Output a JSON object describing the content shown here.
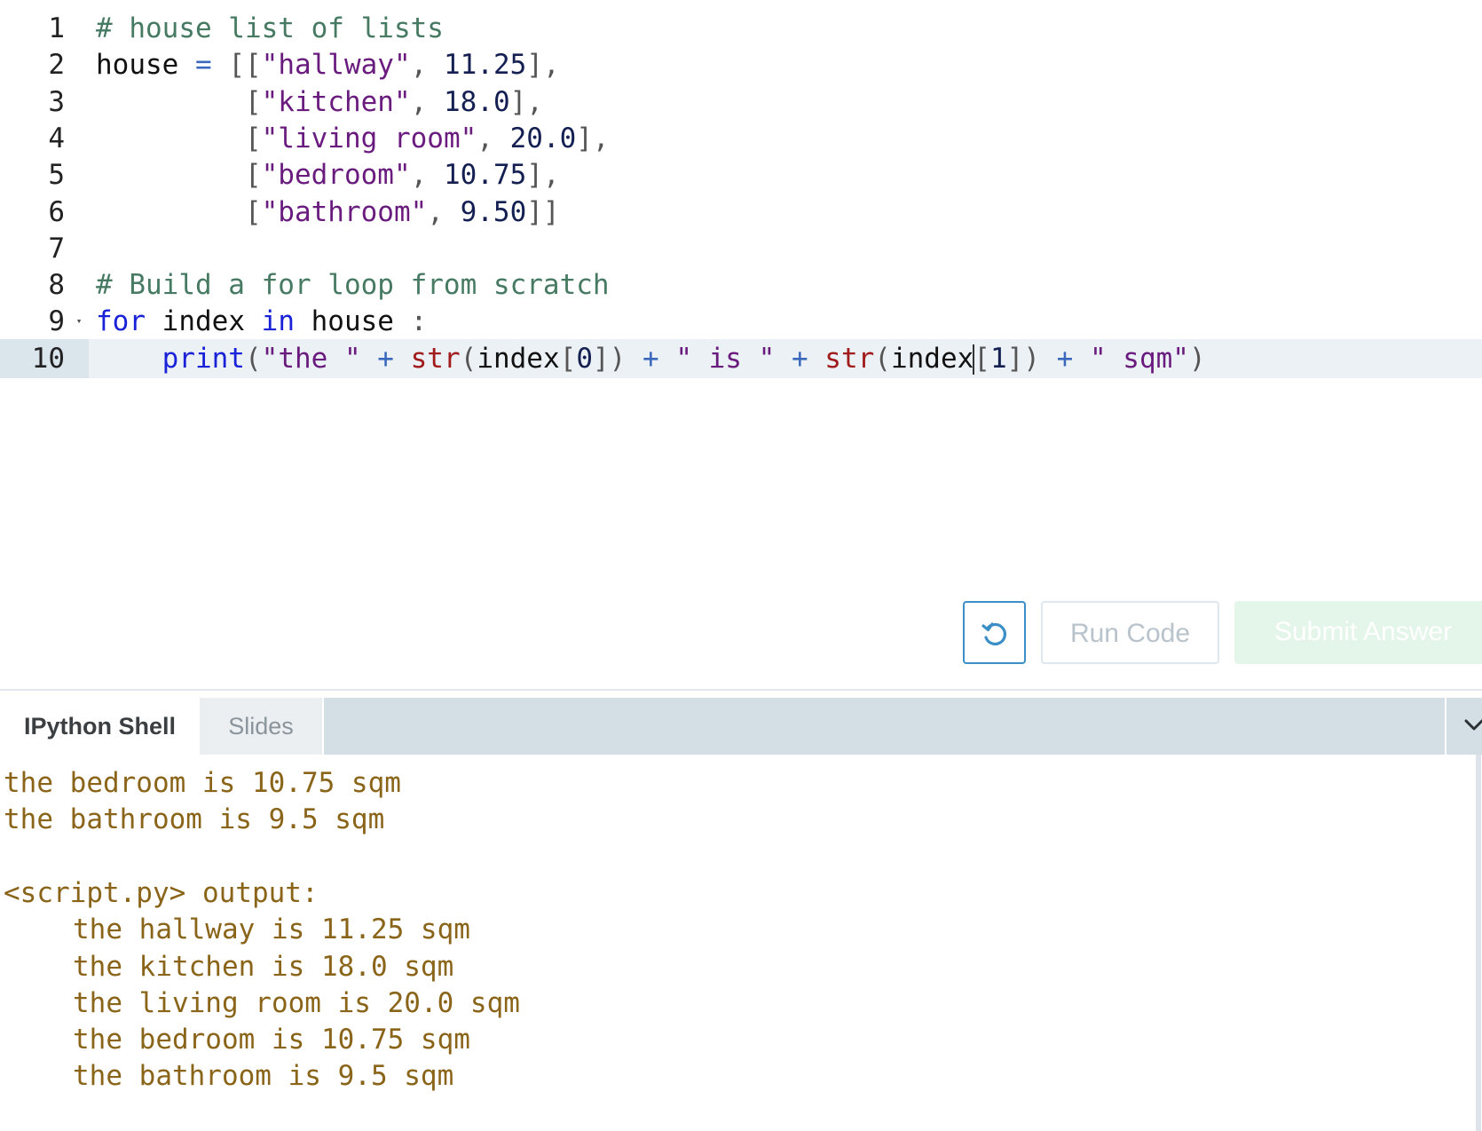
{
  "editor": {
    "active_line": 10,
    "lines": [
      {
        "num": "1",
        "tokens": [
          {
            "t": "# house list of lists",
            "c": "cm"
          }
        ]
      },
      {
        "num": "2",
        "tokens": [
          {
            "t": "house",
            "c": "id"
          },
          {
            "t": " = ",
            "c": "op"
          },
          {
            "t": "[[",
            "c": "pn"
          },
          {
            "t": "\"hallway\"",
            "c": "st"
          },
          {
            "t": ", ",
            "c": "pn"
          },
          {
            "t": "11.25",
            "c": "nm"
          },
          {
            "t": "],",
            "c": "pn"
          }
        ]
      },
      {
        "num": "3",
        "tokens": [
          {
            "t": "         [",
            "c": "pn"
          },
          {
            "t": "\"kitchen\"",
            "c": "st"
          },
          {
            "t": ", ",
            "c": "pn"
          },
          {
            "t": "18.0",
            "c": "nm"
          },
          {
            "t": "],",
            "c": "pn"
          }
        ]
      },
      {
        "num": "4",
        "tokens": [
          {
            "t": "         [",
            "c": "pn"
          },
          {
            "t": "\"living room\"",
            "c": "st"
          },
          {
            "t": ", ",
            "c": "pn"
          },
          {
            "t": "20.0",
            "c": "nm"
          },
          {
            "t": "],",
            "c": "pn"
          }
        ]
      },
      {
        "num": "5",
        "tokens": [
          {
            "t": "         [",
            "c": "pn"
          },
          {
            "t": "\"bedroom\"",
            "c": "st"
          },
          {
            "t": ", ",
            "c": "pn"
          },
          {
            "t": "10.75",
            "c": "nm"
          },
          {
            "t": "],",
            "c": "pn"
          }
        ]
      },
      {
        "num": "6",
        "tokens": [
          {
            "t": "         [",
            "c": "pn"
          },
          {
            "t": "\"bathroom\"",
            "c": "st"
          },
          {
            "t": ", ",
            "c": "pn"
          },
          {
            "t": "9.50",
            "c": "nm"
          },
          {
            "t": "]]",
            "c": "pn"
          }
        ]
      },
      {
        "num": "7",
        "tokens": []
      },
      {
        "num": "8",
        "tokens": [
          {
            "t": "# Build a for loop from scratch",
            "c": "cm"
          }
        ]
      },
      {
        "num": "9",
        "fold": "▾",
        "tokens": [
          {
            "t": "for",
            "c": "kw"
          },
          {
            "t": " index ",
            "c": "id"
          },
          {
            "t": "in",
            "c": "kw"
          },
          {
            "t": " house ",
            "c": "id"
          },
          {
            "t": ":",
            "c": "pn"
          }
        ]
      },
      {
        "num": "10",
        "tokens": [
          {
            "t": "    ",
            "c": "id"
          },
          {
            "t": "print",
            "c": "kw"
          },
          {
            "t": "(",
            "c": "pn"
          },
          {
            "t": "\"the \"",
            "c": "st"
          },
          {
            "t": " + ",
            "c": "op"
          },
          {
            "t": "str",
            "c": "bi"
          },
          {
            "t": "(",
            "c": "pn"
          },
          {
            "t": "index",
            "c": "id"
          },
          {
            "t": "[",
            "c": "pn"
          },
          {
            "t": "0",
            "c": "nm"
          },
          {
            "t": "])",
            "c": "pn"
          },
          {
            "t": " + ",
            "c": "op"
          },
          {
            "t": "\" is \"",
            "c": "st"
          },
          {
            "t": " + ",
            "c": "op"
          },
          {
            "t": "str",
            "c": "bi"
          },
          {
            "t": "(",
            "c": "pn"
          },
          {
            "t": "index",
            "c": "id",
            "cursor_after": true
          },
          {
            "t": "[",
            "c": "pn"
          },
          {
            "t": "1",
            "c": "nm"
          },
          {
            "t": "])",
            "c": "pn"
          },
          {
            "t": " + ",
            "c": "op"
          },
          {
            "t": "\" sqm\"",
            "c": "st"
          },
          {
            "t": ")",
            "c": "pn"
          }
        ]
      }
    ]
  },
  "actions": {
    "reset_icon": "undo-icon",
    "run_label": "Run Code",
    "submit_label": "Submit Answer"
  },
  "console": {
    "tabs": [
      {
        "label": "IPython Shell",
        "active": true
      },
      {
        "label": "Slides",
        "active": false
      }
    ],
    "toggle_icon": "chevron-down-icon",
    "output": [
      {
        "text": "the bedroom is 10.75 sqm",
        "indent": false
      },
      {
        "text": "the bathroom is 9.5 sqm",
        "indent": false
      },
      {
        "text": "",
        "indent": false
      },
      {
        "text": "<script.py> output:",
        "indent": false
      },
      {
        "text": "the hallway is 11.25 sqm",
        "indent": true
      },
      {
        "text": "the kitchen is 18.0 sqm",
        "indent": true
      },
      {
        "text": "the living room is 20.0 sqm",
        "indent": true
      },
      {
        "text": "the bedroom is 10.75 sqm",
        "indent": true
      },
      {
        "text": "the bathroom is 9.5 sqm",
        "indent": true
      }
    ]
  },
  "colors": {
    "comment": "#477a63",
    "string": "#6a1b7e",
    "number": "#141f52",
    "keyword": "#1a22d8",
    "builtin": "#a11b1b",
    "operator": "#3a68bd",
    "output_text": "#8a6419",
    "accent_blue": "#3b8fc6",
    "active_line_bg": "#ebf1f5",
    "tabbar_bg": "#d4dee5"
  }
}
